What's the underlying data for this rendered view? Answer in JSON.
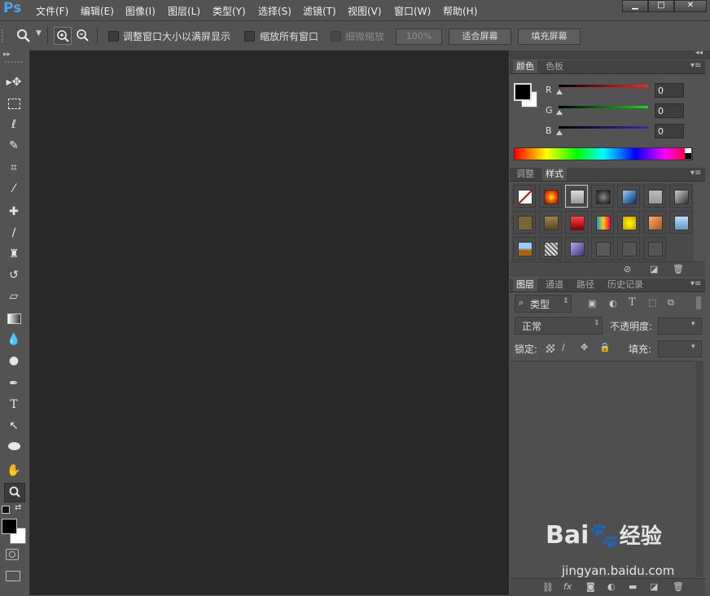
{
  "app": {
    "logo": "Ps"
  },
  "menu": [
    "文件(F)",
    "编辑(E)",
    "图像(I)",
    "图层(L)",
    "类型(Y)",
    "选择(S)",
    "滤镜(T)",
    "视图(V)",
    "窗口(W)",
    "帮助(H)"
  ],
  "window_buttons": {
    "minimize": "▁",
    "maximize": "□",
    "close": "✕"
  },
  "options": {
    "zoom_icon": "🔍",
    "resize_windows": "调整窗口大小以满屏显示",
    "zoom_all": "缩放所有窗口",
    "scrubby": "细微缩放",
    "zoom_value": "100%",
    "fit_screen": "适合屏幕",
    "fill_screen": "填充屏幕"
  },
  "color_panel": {
    "tabs": [
      "颜色",
      "色板"
    ],
    "channels": [
      {
        "label": "R",
        "value": "0",
        "color": "#e53030"
      },
      {
        "label": "G",
        "value": "0",
        "color": "#2ecc2e"
      },
      {
        "label": "B",
        "value": "0",
        "color": "#2a2ae0"
      }
    ]
  },
  "styles_panel": {
    "tabs": [
      "调整",
      "样式"
    ]
  },
  "layers_panel": {
    "tabs": [
      "图层",
      "通道",
      "路径",
      "历史记录"
    ],
    "filter_label": "类型",
    "blend_mode": "正常",
    "opacity_label": "不透明度:",
    "lock_label": "锁定:",
    "fill_label": "填充:"
  },
  "watermark": {
    "text": "jingyan.baidu.com",
    "brand": "Bai",
    "brand2": "经验"
  }
}
